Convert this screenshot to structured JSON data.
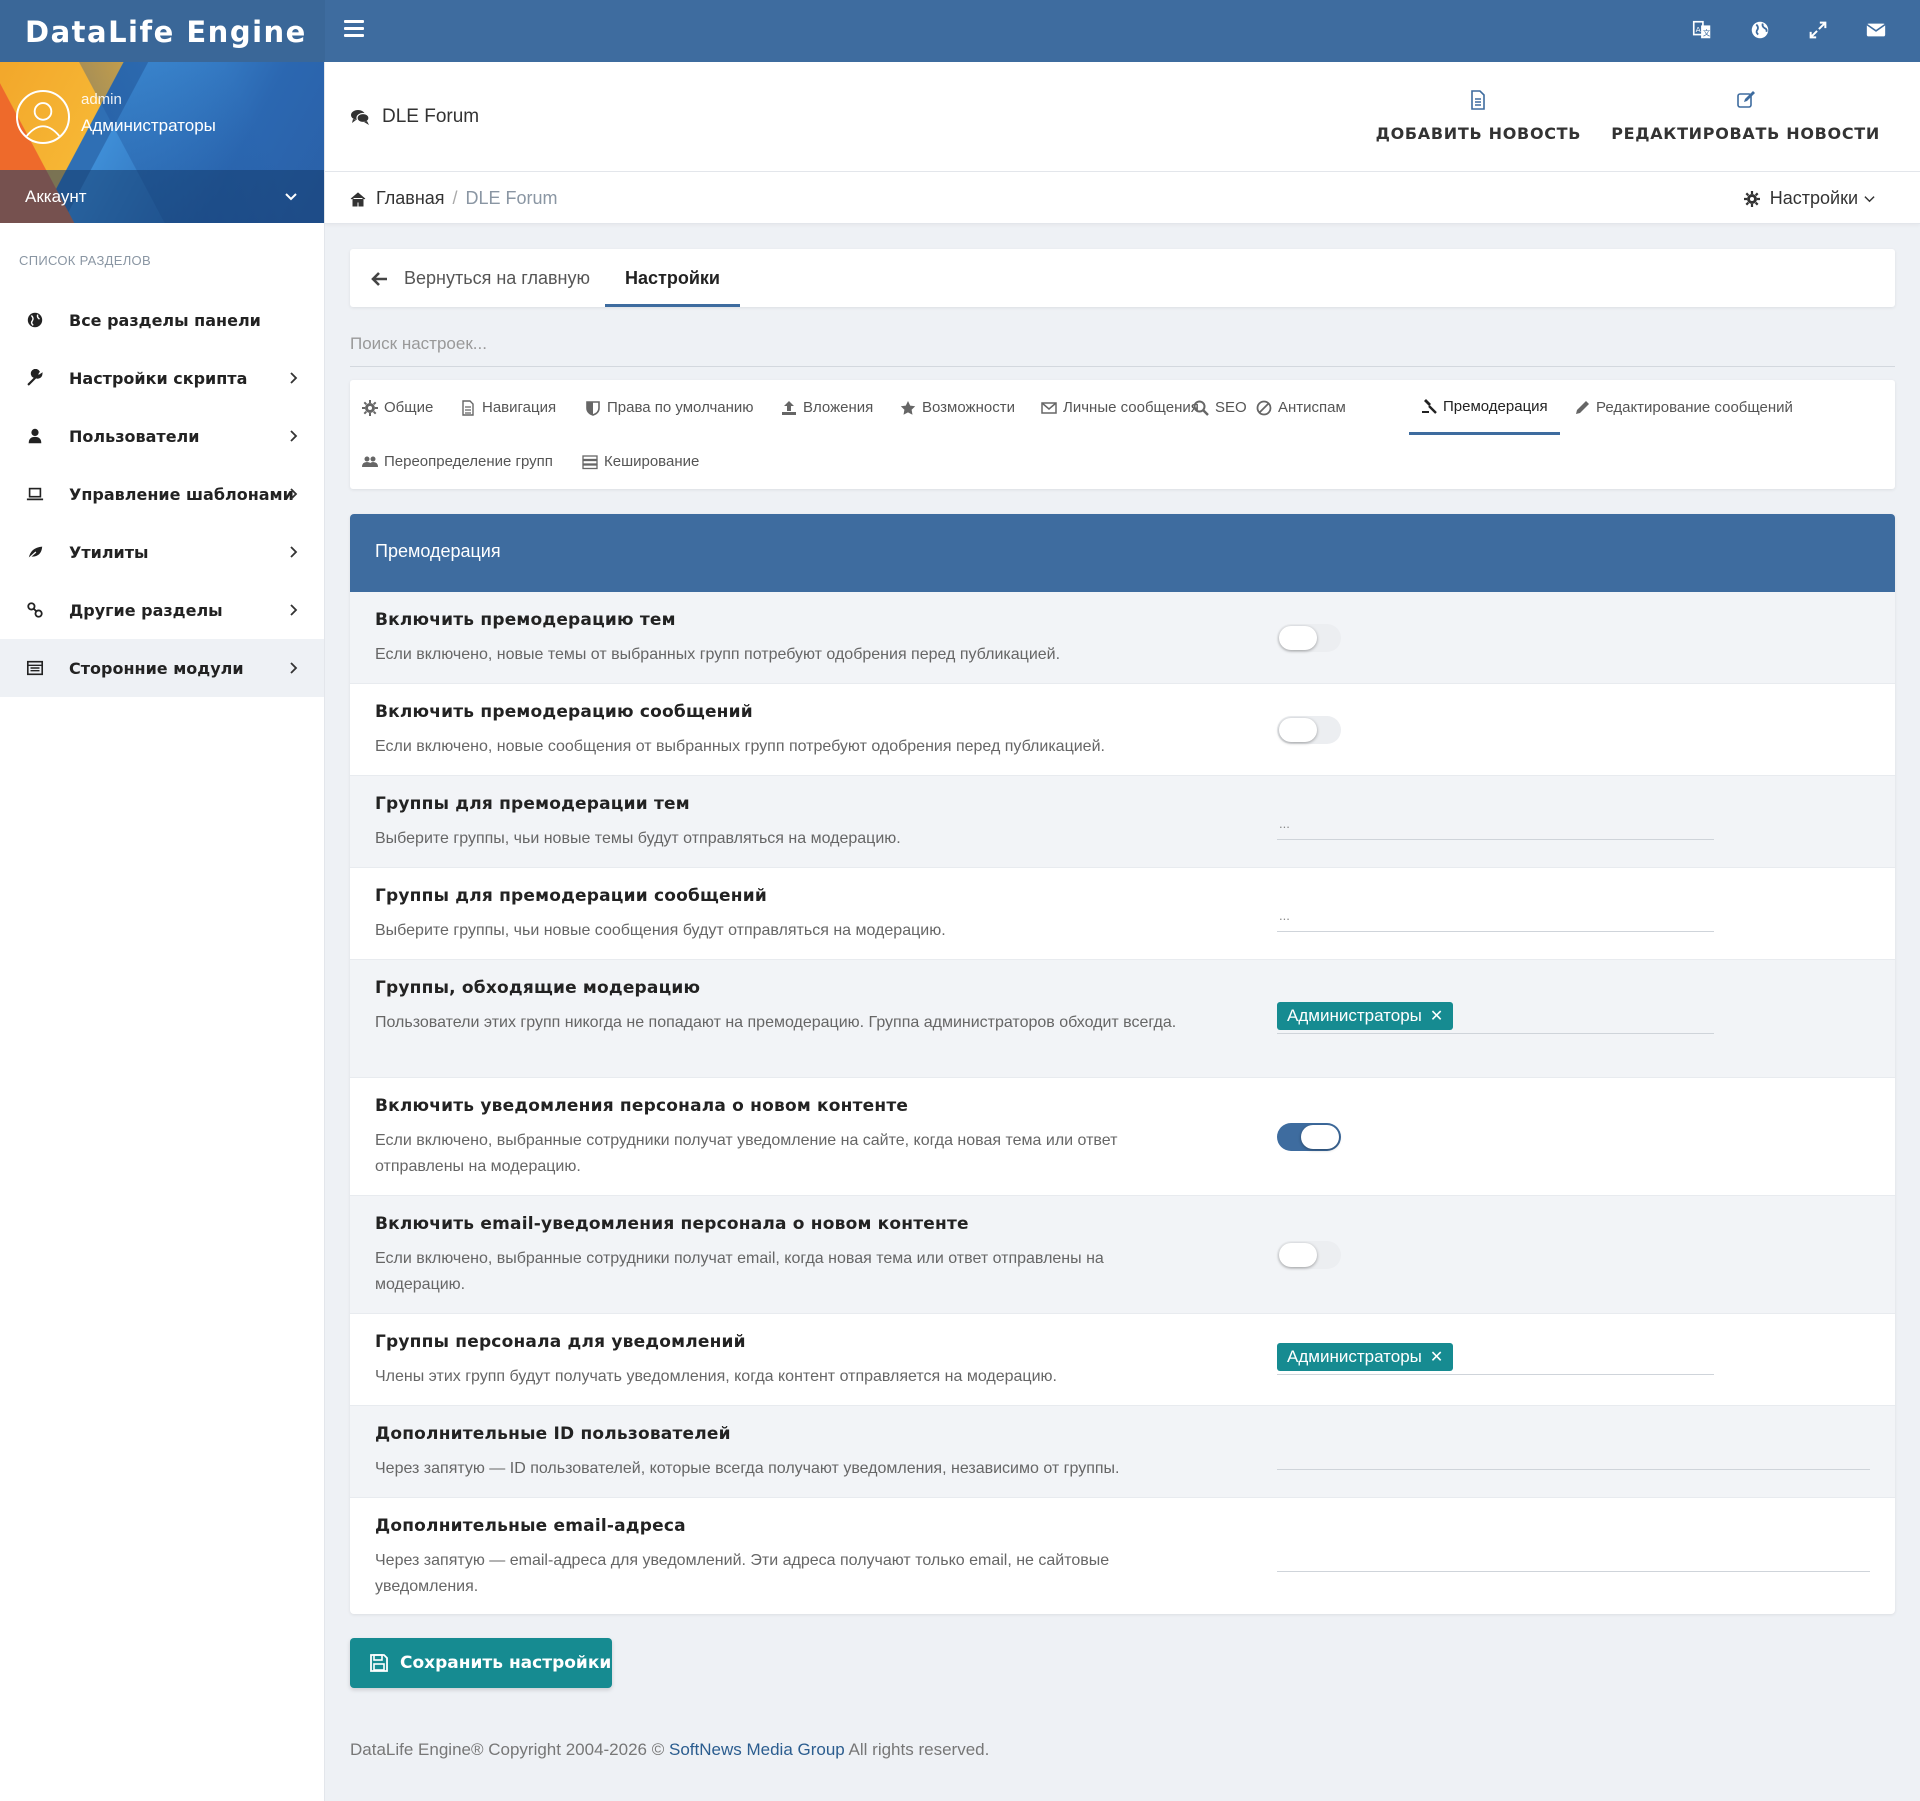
{
  "navbar": {
    "brand": "DataLife Engine",
    "icons": [
      "translate-icon",
      "globe-icon",
      "fullscreen-icon",
      "mail-icon"
    ]
  },
  "profile": {
    "name": "admin",
    "group": "Администраторы",
    "account_label": "Аккаунт"
  },
  "sidebar": {
    "title": "СПИСОК РАЗДЕЛОВ",
    "items": [
      {
        "label": "Все разделы панели",
        "icon": "globe-icon"
      },
      {
        "label": "Настройки скрипта",
        "icon": "wrench-icon"
      },
      {
        "label": "Пользователи",
        "icon": "user-icon"
      },
      {
        "label": "Управление шаблонами",
        "icon": "laptop-icon"
      },
      {
        "label": "Утилиты",
        "icon": "leaf-icon"
      },
      {
        "label": "Другие разделы",
        "icon": "link-icon"
      },
      {
        "label": "Сторонние модули",
        "icon": "list-icon"
      }
    ]
  },
  "header": {
    "title": "DLE Forum",
    "actions": {
      "add_news": "ДОБАВИТЬ НОВОСТЬ",
      "edit_news": "РЕДАКТИРОВАТЬ НОВОСТИ"
    }
  },
  "breadcrumb": {
    "home": "Главная",
    "separator": "/",
    "current": "DLE Forum",
    "settings": "Настройки"
  },
  "tabs": {
    "back": "Вернуться на главную",
    "active": "Настройки"
  },
  "search": {
    "placeholder": "Поиск настроек..."
  },
  "subtabs": [
    {
      "label": "Общие",
      "icon": "gear-icon"
    },
    {
      "label": "Навигация",
      "icon": "document-icon"
    },
    {
      "label": "Права по умолчанию",
      "icon": "shield-icon"
    },
    {
      "label": "Вложения",
      "icon": "upload-icon"
    },
    {
      "label": "Возможности",
      "icon": "star-icon"
    },
    {
      "label": "Личные сообщения",
      "icon": "envelope-icon"
    },
    {
      "label": "SEO",
      "icon": "search-icon"
    },
    {
      "label": "Антиспам",
      "icon": "ban-icon"
    },
    {
      "label": "Премодерация",
      "icon": "gavel-icon"
    },
    {
      "label": "Редактирование сообщений",
      "icon": "pencil-icon"
    },
    {
      "label": "Переопределение групп",
      "icon": "users-icon"
    },
    {
      "label": "Кеширование",
      "icon": "server-icon"
    }
  ],
  "panel": {
    "title": "Премодерация",
    "rows": [
      {
        "title": "Включить премодерацию тем",
        "desc": "Если включено, новые темы от выбранных групп потребуют одобрения перед публикацией.",
        "control": "toggle",
        "value": false
      },
      {
        "title": "Включить премодерацию сообщений",
        "desc": "Если включено, новые сообщения от выбранных групп потребуют одобрения перед публикацией.",
        "control": "toggle",
        "value": false
      },
      {
        "title": "Группы для премодерации тем",
        "desc": "Выберите группы, чьи новые темы будут отправляться на модерацию.",
        "control": "select",
        "placeholder": "..."
      },
      {
        "title": "Группы для премодерации сообщений",
        "desc": "Выберите группы, чьи новые сообщения будут отправляться на модерацию.",
        "control": "select",
        "placeholder": "..."
      },
      {
        "title": "Группы, обходящие модерацию",
        "desc": "Пользователи этих групп никогда не попадают на премодерацию. Группа администраторов обходит всегда.",
        "control": "select",
        "tag": "Администраторы"
      },
      {
        "title": "Включить уведомления персонала о новом контенте",
        "desc": "Если включено, выбранные сотрудники получат уведомление на сайте, когда новая тема или ответ отправлены на модерацию.",
        "control": "toggle",
        "value": true
      },
      {
        "title": "Включить email-уведомления персонала о новом контенте",
        "desc": "Если включено, выбранные сотрудники получат email, когда новая тема или ответ отправлены на модерацию.",
        "control": "toggle",
        "value": false
      },
      {
        "title": "Группы персонала для уведомлений",
        "desc": "Члены этих групп будут получать уведомления, когда контент отправляется на модерацию.",
        "control": "select",
        "tag": "Администраторы"
      },
      {
        "title": "Дополнительные ID пользователей",
        "desc": "Через запятую — ID пользователей, которые всегда получают уведомления, независимо от группы.",
        "control": "text",
        "value": ""
      },
      {
        "title": "Дополнительные email-адреса",
        "desc": "Через запятую — email-адреса для уведомлений. Эти адреса получают только email, не сайтовые уведомления.",
        "control": "text",
        "value": ""
      }
    ]
  },
  "save_button": "Сохранить настройки",
  "footer": {
    "prefix": "DataLife Engine® Copyright 2004-2026 ©",
    "link": "SoftNews Media Group",
    "suffix": "All rights reserved."
  },
  "colors": {
    "primary": "#3e6c9f",
    "teal": "#168b91"
  }
}
